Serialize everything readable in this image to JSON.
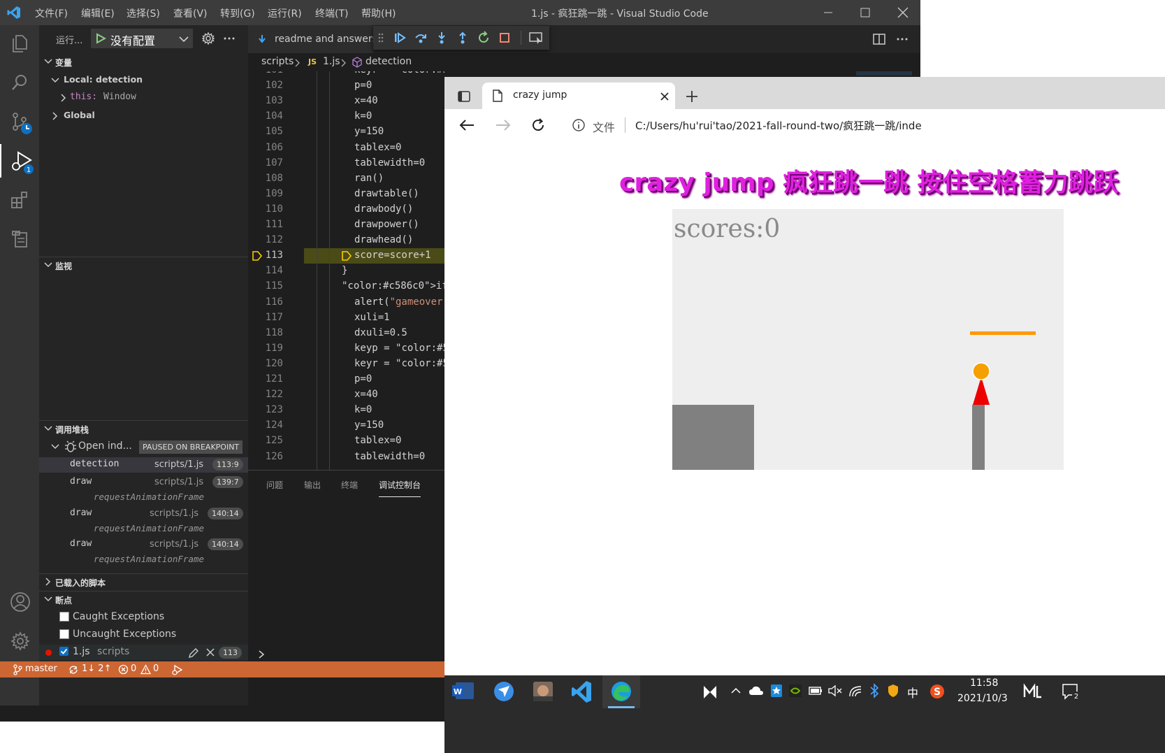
{
  "vscode": {
    "menu": [
      "文件(F)",
      "编辑(E)",
      "选择(S)",
      "查看(V)",
      "转到(G)",
      "运行(R)",
      "终端(T)",
      "帮助(H)"
    ],
    "window_title": "1.js - 疯狂跳一跳 - Visual Studio Code",
    "activity_badges": {
      "debug": "1"
    },
    "run_label": "运行...",
    "config_label": "没有配置",
    "sections": {
      "variables": "变量",
      "watch": "监视",
      "call_stack": "调用堆栈",
      "loaded_scripts": "已载入的脚本",
      "breakpoints": "断点"
    },
    "variables": {
      "scope_local": "Local: detection",
      "this_key": "this:",
      "this_value": "Window",
      "scope_global": "Global"
    },
    "call_stack": {
      "thread_label": "Open ind...",
      "paused_badge": "PAUSED ON BREAKPOINT",
      "frames": [
        {
          "name": "detection",
          "file": "scripts/1.js",
          "pos": "113:9"
        },
        {
          "name": "draw",
          "file": "scripts/1.js",
          "pos": "139:7"
        },
        {
          "separator": "requestAnimationFrame"
        },
        {
          "name": "draw",
          "file": "scripts/1.js",
          "pos": "140:14"
        },
        {
          "separator": "requestAnimationFrame"
        },
        {
          "name": "draw",
          "file": "scripts/1.js",
          "pos": "140:14"
        },
        {
          "separator": "requestAnimationFrame"
        }
      ]
    },
    "breakpoints": {
      "caught": "Caught Exceptions",
      "uncaught": "Uncaught Exceptions",
      "file": "1.js",
      "folder": "scripts",
      "line": "113"
    },
    "editor": {
      "tab_label": "readme and answers",
      "breadcrumb": {
        "folder": "scripts",
        "file_badge": "JS",
        "file": "1.js",
        "symbol": "detection"
      },
      "current_line": 113,
      "lines": [
        {
          "n": "101",
          "indent": 2,
          "code": "keyr = false"
        },
        {
          "n": "102",
          "indent": 2,
          "code": "p=0"
        },
        {
          "n": "103",
          "indent": 2,
          "code": "x=40"
        },
        {
          "n": "104",
          "indent": 2,
          "code": "k=0"
        },
        {
          "n": "105",
          "indent": 2,
          "code": "y=150"
        },
        {
          "n": "106",
          "indent": 2,
          "code": "tablex=0"
        },
        {
          "n": "107",
          "indent": 2,
          "code": "tablewidth=0"
        },
        {
          "n": "108",
          "indent": 2,
          "code": "ran()"
        },
        {
          "n": "109",
          "indent": 2,
          "code": "drawtable()"
        },
        {
          "n": "110",
          "indent": 2,
          "code": "drawbody()"
        },
        {
          "n": "111",
          "indent": 2,
          "code": "drawpower()"
        },
        {
          "n": "112",
          "indent": 2,
          "code": "drawhead()"
        },
        {
          "n": "113",
          "indent": 2,
          "code": "score=score+1"
        },
        {
          "n": "114",
          "indent": 1,
          "code": "}"
        },
        {
          "n": "115",
          "indent": 1,
          "code": "if(y>320){"
        },
        {
          "n": "116",
          "indent": 2,
          "code": "alert(\"gameover"
        },
        {
          "n": "117",
          "indent": 2,
          "code": "xuli=1"
        },
        {
          "n": "118",
          "indent": 2,
          "code": "dxuli=0.5"
        },
        {
          "n": "119",
          "indent": 2,
          "code": "keyp = false"
        },
        {
          "n": "120",
          "indent": 2,
          "code": "keyr = false"
        },
        {
          "n": "121",
          "indent": 2,
          "code": "p=0"
        },
        {
          "n": "122",
          "indent": 2,
          "code": "x=40"
        },
        {
          "n": "123",
          "indent": 2,
          "code": "k=0"
        },
        {
          "n": "124",
          "indent": 2,
          "code": "y=150"
        },
        {
          "n": "125",
          "indent": 2,
          "code": "tablex=0"
        },
        {
          "n": "126",
          "indent": 2,
          "code": "tablewidth=0"
        }
      ]
    },
    "panel_tabs": [
      "问题",
      "输出",
      "终端",
      "调试控制台"
    ],
    "active_panel_tab": "调试控制台",
    "status": {
      "branch": "master",
      "sync": "1↓ 2↑",
      "errors": "0",
      "warnings": "0"
    },
    "colors": {
      "status_bar": "#cc6633",
      "keyword": "#569cd6",
      "breakpoint_line": "#4b4b18",
      "breakpoint_arrow": "#ffcc00"
    }
  },
  "browser": {
    "tab_title": "crazy jump",
    "address_label": "文件",
    "address": "C:/Users/hu'rui'tao/2021-fall-round-two/疯狂跳一跳/inde",
    "heading": "crazy jump 疯狂跳一跳 按住空格蓄力跳跃",
    "score_text": "scores:0",
    "colors": {
      "heading": "#e020e0",
      "platform": "#ff9900",
      "ball": "#f5a000",
      "body": "#ee0000",
      "pillar": "#808080",
      "canvas": "#eeeeee"
    }
  },
  "taskbar": {
    "apps": [
      "word",
      "feishu",
      "photo",
      "vscode",
      "edge"
    ],
    "time": "11:58",
    "date": "2021/10/3",
    "ime": "中",
    "notification_count": "2"
  }
}
